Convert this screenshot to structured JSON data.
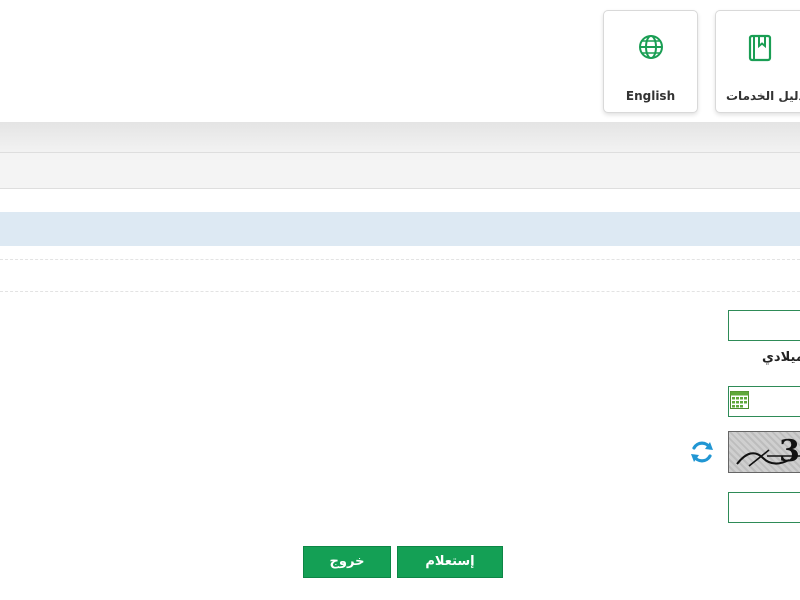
{
  "header": {
    "english_label": "English",
    "guide_label": "دليل الخدمات",
    "english_icon": "globe-icon",
    "guide_icon": "book-icon"
  },
  "form": {
    "date_type_label": "ميلادي",
    "captcha_text": "3",
    "captcha_icon": "refresh-icon",
    "calendar_icon": "calendar-icon"
  },
  "buttons": {
    "inquiry_label": "إستعلام",
    "exit_label": "خروج"
  },
  "colors": {
    "accent_green": "#14a055",
    "field_border": "#2e8b57",
    "info_band": "#dde9f3",
    "refresh_blue": "#2196d3"
  }
}
